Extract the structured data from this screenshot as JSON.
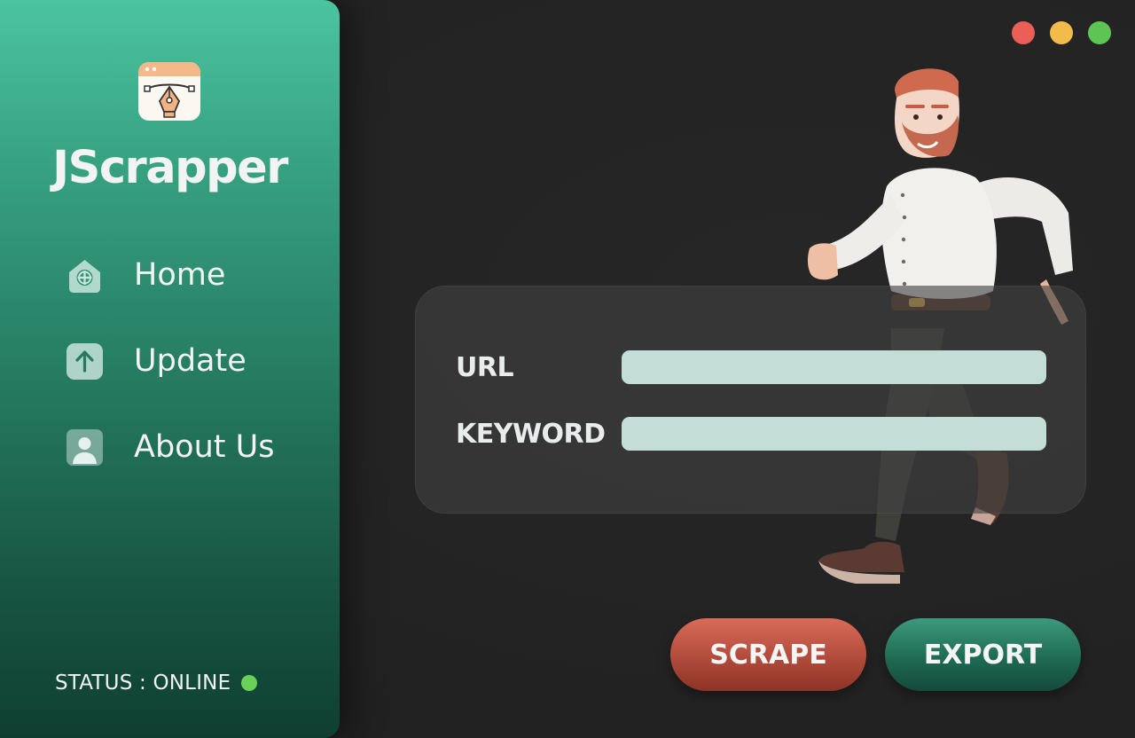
{
  "app": {
    "title": "JScrapper"
  },
  "window_controls": {
    "close_color": "#ec5f56",
    "minimize_color": "#f3bc4a",
    "maximize_color": "#5ec554"
  },
  "sidebar": {
    "items": [
      {
        "label": "Home",
        "icon": "home-icon"
      },
      {
        "label": "Update",
        "icon": "upload-arrow-icon"
      },
      {
        "label": "About Us",
        "icon": "user-profile-icon"
      }
    ],
    "status_text": "STATUS : ONLINE",
    "status_color": "#6ad058"
  },
  "form": {
    "url_label": "URL",
    "url_value": "",
    "keyword_label": "KEYWORD",
    "keyword_value": ""
  },
  "actions": {
    "scrape_label": "SCRAPE",
    "export_label": "EXPORT"
  },
  "colors": {
    "sidebar_top": "#4cc4a0",
    "sidebar_bottom": "#0f3f31",
    "input_fill": "#c4ddd6",
    "scrape_button": "#c35a4a",
    "export_button": "#2a7f64",
    "background": "#262626"
  }
}
